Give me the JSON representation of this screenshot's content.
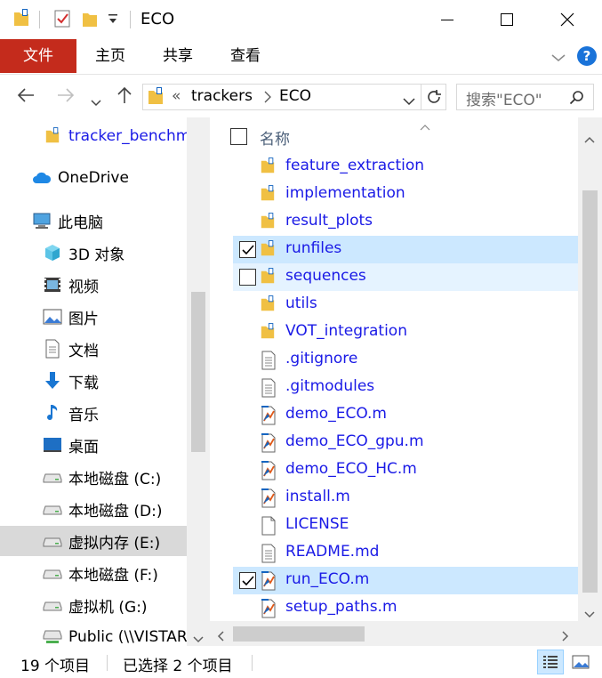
{
  "window": {
    "title": "ECO",
    "minimize_icon": "minimize-icon",
    "maximize_icon": "maximize-icon",
    "close_icon": "close-icon"
  },
  "ribbon": {
    "tabs": [
      {
        "label": "文件"
      },
      {
        "label": "主页"
      },
      {
        "label": "共享"
      },
      {
        "label": "查看"
      }
    ],
    "help_label": "?"
  },
  "address": {
    "overflow": "«",
    "crumbs": [
      "trackers",
      "ECO"
    ],
    "search_placeholder": "搜索\"ECO\""
  },
  "nav": {
    "items": [
      {
        "label": "tracker_benchmark",
        "icon": "folder-icon"
      },
      {
        "label": "OneDrive",
        "icon": "cloud-icon"
      },
      {
        "label": "此电脑",
        "icon": "computer-icon"
      },
      {
        "label": "3D 对象",
        "icon": "cube-icon"
      },
      {
        "label": "视频",
        "icon": "video-icon"
      },
      {
        "label": "图片",
        "icon": "picture-icon"
      },
      {
        "label": "文档",
        "icon": "document-icon"
      },
      {
        "label": "下载",
        "icon": "download-icon"
      },
      {
        "label": "音乐",
        "icon": "music-icon"
      },
      {
        "label": "桌面",
        "icon": "desktop-icon"
      },
      {
        "label": "本地磁盘 (C:)",
        "icon": "drive-icon"
      },
      {
        "label": "本地磁盘 (D:)",
        "icon": "drive-icon"
      },
      {
        "label": "虚拟内存 (E:)",
        "icon": "drive-icon"
      },
      {
        "label": "本地磁盘 (F:)",
        "icon": "drive-icon"
      },
      {
        "label": "虚拟机 (G:)",
        "icon": "drive-icon"
      },
      {
        "label": "Public (\\\\VISTAR",
        "icon": "network-drive-icon"
      }
    ]
  },
  "content": {
    "column_name": "名称",
    "files": [
      {
        "name": "feature_extraction",
        "type": "folder",
        "checked": false
      },
      {
        "name": "implementation",
        "type": "folder",
        "checked": false
      },
      {
        "name": "result_plots",
        "type": "folder",
        "checked": false
      },
      {
        "name": "runfiles",
        "type": "folder",
        "checked": true
      },
      {
        "name": "sequences",
        "type": "folder",
        "checked": false
      },
      {
        "name": "utils",
        "type": "folder",
        "checked": false
      },
      {
        "name": "VOT_integration",
        "type": "folder",
        "checked": false
      },
      {
        "name": ".gitignore",
        "type": "text",
        "checked": false
      },
      {
        "name": ".gitmodules",
        "type": "text",
        "checked": false
      },
      {
        "name": "demo_ECO.m",
        "type": "matlab",
        "checked": false
      },
      {
        "name": "demo_ECO_gpu.m",
        "type": "matlab",
        "checked": false
      },
      {
        "name": "demo_ECO_HC.m",
        "type": "matlab",
        "checked": false
      },
      {
        "name": "install.m",
        "type": "matlab",
        "checked": false
      },
      {
        "name": "LICENSE",
        "type": "blank",
        "checked": false
      },
      {
        "name": "README.md",
        "type": "text",
        "checked": false
      },
      {
        "name": "run_ECO.m",
        "type": "matlab",
        "checked": true
      },
      {
        "name": "setup_paths.m",
        "type": "matlab",
        "checked": false
      }
    ]
  },
  "status": {
    "item_count": "19 个项目",
    "selected_count": "已选择 2 个项目"
  },
  "colors": {
    "file_tab": "#c42b1c",
    "selection": "#cce8ff",
    "hover": "#e5f3ff",
    "link_text": "#1a1ae6",
    "folder": "#f0c043"
  }
}
